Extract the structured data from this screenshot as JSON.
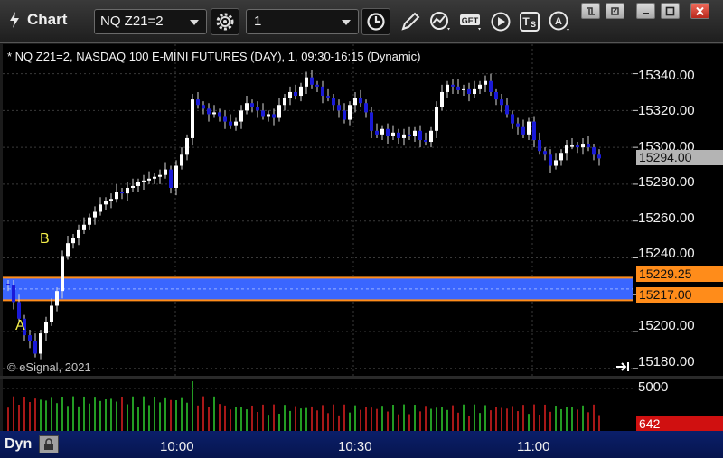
{
  "window": {
    "title": "Chart"
  },
  "toolbar": {
    "symbol": "NQ Z21=2",
    "interval": "1",
    "icons": [
      "settings-gear-icon",
      "clock-icon",
      "pencil-draw-icon",
      "indicator-icon",
      "get-data-icon",
      "play-icon",
      "text-tool-icon",
      "alert-icon"
    ]
  },
  "chart": {
    "info_line": "* NQ Z21=2, NASDAQ 100 E-MINI FUTURES (DAY), 1, 09:30-16:15 (Dynamic)",
    "watermark": "© eSignal, 2021",
    "mark_a": "A",
    "mark_b": "B",
    "price_axis_labels": [
      "15340.00",
      "15320.00",
      "15300.00",
      "15280.00",
      "15260.00",
      "15240.00",
      "15200.00",
      "15180.00"
    ],
    "last_price_tag": "15294.00",
    "zone_top_tag": "15229.25",
    "zone_bottom_tag": "15217.00",
    "volume_axis_label": "5000",
    "volume_last_tag": "642",
    "time_labels": [
      "10:00",
      "10:30",
      "11:00"
    ],
    "dyn_label": "Dyn",
    "colors": {
      "up": "#ffffff",
      "down": "#1a1ad8",
      "zone": "#3a66ff",
      "zone_border": "#ff8c1a",
      "vol_up": "#2fd12f",
      "vol_down": "#e02020",
      "tag_gray": "#b4b4b4",
      "tag_red": "#d01010"
    }
  },
  "chart_data": {
    "type": "candlestick",
    "title": "",
    "ylim": [
      15175,
      15355
    ],
    "xlim_minutes": [
      "09:30",
      "11:25"
    ],
    "zone": {
      "top": 15229.25,
      "bottom": 15217.0
    },
    "closes": [
      15225,
      15216,
      15207,
      15198,
      15195,
      15188,
      15199,
      15205,
      15214,
      15222,
      15241,
      15248,
      15251,
      15255,
      15258,
      15262,
      15265,
      15269,
      15271,
      15272,
      15276,
      15275,
      15278,
      15279,
      15281,
      15282,
      15283,
      15284,
      15285,
      15288,
      15278,
      15290,
      15296,
      15305,
      15326,
      15323,
      15321,
      15318,
      15319,
      15317,
      15314,
      15312,
      15314,
      15320,
      15324,
      15322,
      15320,
      15317,
      15318,
      15316,
      15323,
      15327,
      15330,
      15328,
      15333,
      15338,
      15334,
      15333,
      15328,
      15327,
      15323,
      15320,
      15315,
      15323,
      15327,
      15324,
      15319,
      15309,
      15307,
      15310,
      15306,
      15308,
      15305,
      15307,
      15306,
      15309,
      15304,
      15303,
      15309,
      15322,
      15330,
      15334,
      15333,
      15331,
      15332,
      15329,
      15332,
      15334,
      15336,
      15330,
      15326,
      15323,
      15318,
      15313,
      15311,
      15307,
      15314,
      15304,
      15298,
      15296,
      15290,
      15293,
      15297,
      15301,
      15301,
      15300,
      15302,
      15300,
      15296,
      15294
    ],
    "volume_ylim": [
      0,
      5000
    ]
  }
}
